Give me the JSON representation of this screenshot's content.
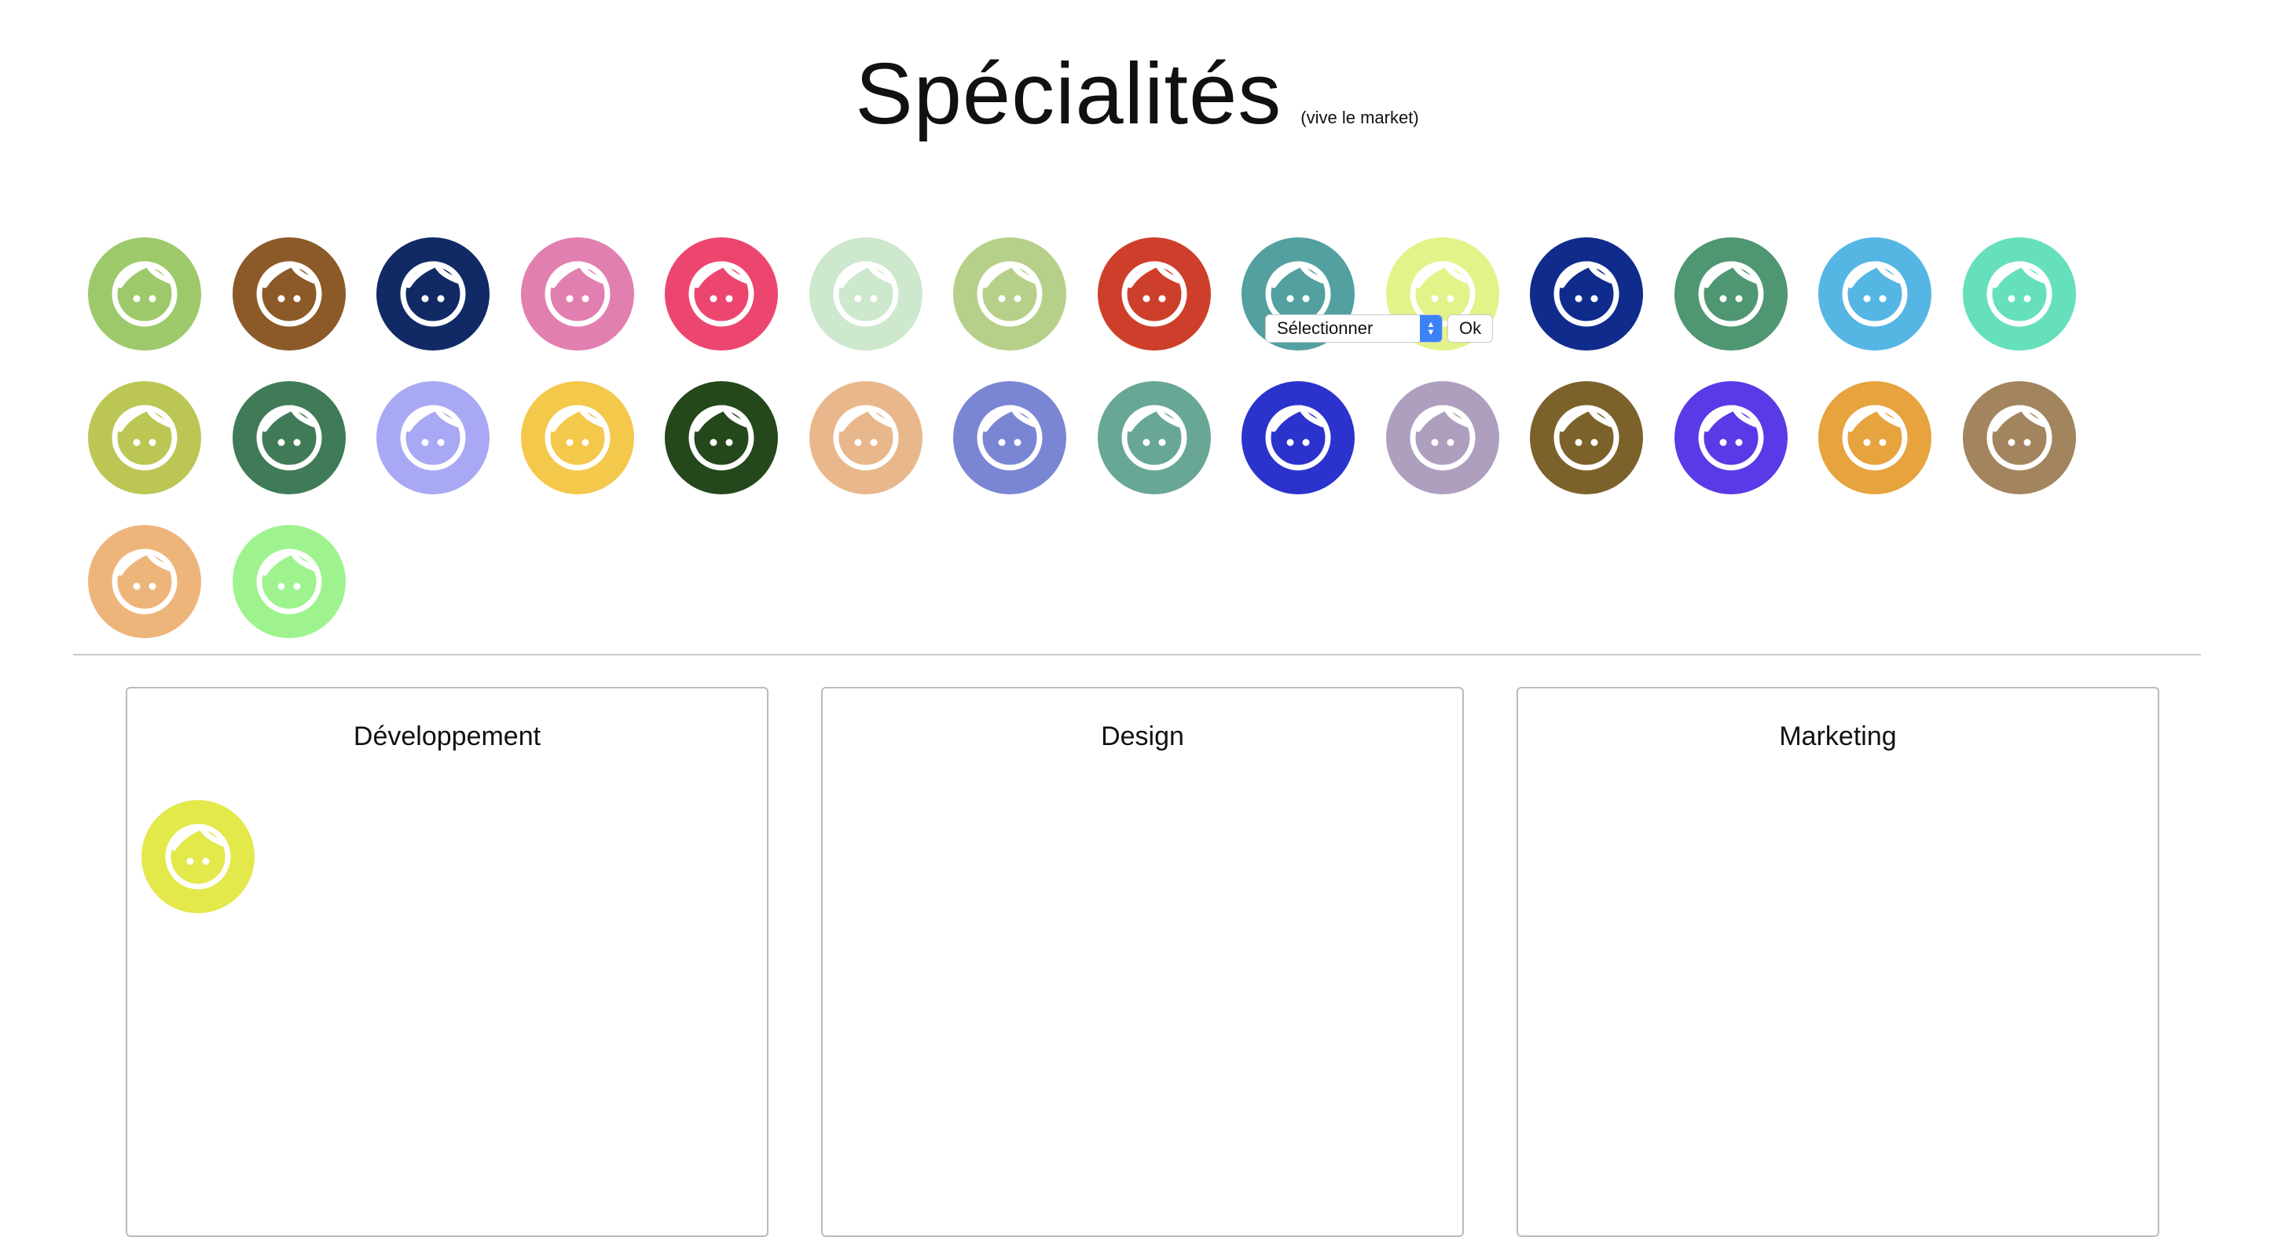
{
  "header": {
    "title": "Spécialités",
    "subtitle": "(vive le market)"
  },
  "pool": {
    "avatars": [
      {
        "color": "#9dc96a"
      },
      {
        "color": "#8b5a28"
      },
      {
        "color": "#112a66"
      },
      {
        "color": "#e27fb1"
      },
      {
        "color": "#ec466f"
      },
      {
        "color": "#cde8cd"
      },
      {
        "color": "#b6d08a"
      },
      {
        "color": "#cd3f2b"
      },
      {
        "color": "#53a0a0"
      },
      {
        "color": "#e4f28a"
      },
      {
        "color": "#0f2b8c"
      },
      {
        "color": "#4f9672"
      },
      {
        "color": "#55b6e4"
      },
      {
        "color": "#66dfbd"
      },
      {
        "color": "#bcc654"
      },
      {
        "color": "#3f7b56"
      },
      {
        "color": "#a9a8f4"
      },
      {
        "color": "#f4c84b"
      },
      {
        "color": "#24471b"
      },
      {
        "color": "#e8b88c"
      },
      {
        "color": "#7a86d4"
      },
      {
        "color": "#68a695"
      },
      {
        "color": "#2b33cc"
      },
      {
        "color": "#ae9fbf"
      },
      {
        "color": "#7b622b"
      },
      {
        "color": "#5a39e6"
      },
      {
        "color": "#e6a33e"
      },
      {
        "color": "#a2855e"
      },
      {
        "color": "#eeb57b"
      },
      {
        "color": "#9ef38e"
      }
    ]
  },
  "selector": {
    "select_label": "Sélectionner",
    "ok_label": "Ok"
  },
  "columns": [
    {
      "title": "Développement",
      "avatars": [
        {
          "color": "#e3e84b"
        }
      ]
    },
    {
      "title": "Design",
      "avatars": []
    },
    {
      "title": "Marketing",
      "avatars": []
    }
  ]
}
